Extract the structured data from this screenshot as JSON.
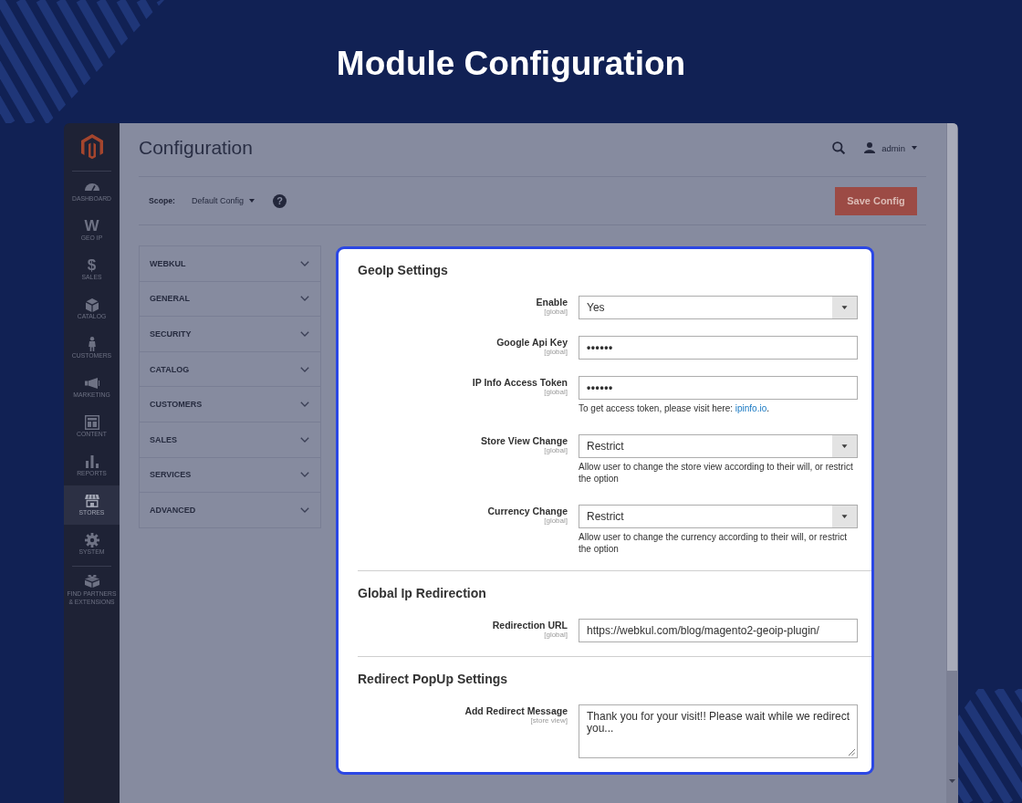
{
  "title": "Module Configuration",
  "admin_sidebar": {
    "items": [
      {
        "label": "DASHBOARD",
        "selected": false
      },
      {
        "label": "GEO IP",
        "glyph": "W",
        "selected": false
      },
      {
        "label": "SALES",
        "glyph": "$",
        "selected": false
      },
      {
        "label": "CATALOG",
        "selected": false
      },
      {
        "label": "CUSTOMERS",
        "selected": false
      },
      {
        "label": "MARKETING",
        "selected": false
      },
      {
        "label": "CONTENT",
        "selected": false
      },
      {
        "label": "REPORTS",
        "selected": false
      },
      {
        "label": "STORES",
        "selected": true
      },
      {
        "label": "SYSTEM",
        "selected": false
      },
      {
        "label": "FIND PARTNERS & EXTENSIONS",
        "selected": false
      }
    ]
  },
  "header": {
    "page_title": "Configuration",
    "user": "admin"
  },
  "scope_bar": {
    "label": "Scope:",
    "value": "Default Config",
    "help": "?",
    "save_button": "Save Config"
  },
  "config_tabs": [
    {
      "label": "WEBKUL",
      "expanded": false
    },
    {
      "label": "GENERAL",
      "expanded": false
    },
    {
      "label": "SECURITY",
      "expanded": false
    },
    {
      "label": "CATALOG",
      "expanded": false
    },
    {
      "label": "CUSTOMERS",
      "expanded": false
    },
    {
      "label": "SALES",
      "expanded": false
    },
    {
      "label": "SERVICES",
      "expanded": false
    },
    {
      "label": "ADVANCED",
      "expanded": false
    }
  ],
  "settings_panel": {
    "sections": [
      {
        "title": "GeoIp Settings",
        "fields": [
          {
            "kind": "select",
            "label": "Enable",
            "scope": "[global]",
            "value": "Yes"
          },
          {
            "kind": "password",
            "label": "Google Api Key",
            "scope": "[global]",
            "value": "••••••"
          },
          {
            "kind": "password",
            "label": "IP Info Access Token",
            "scope": "[global]",
            "value": "••••••",
            "note": "To get access token, please visit here: ",
            "note_link": "ipinfo.io",
            "note_end": "."
          },
          {
            "kind": "select",
            "label": "Store View Change",
            "scope": "[global]",
            "value": "Restrict",
            "note": "Allow user to change the store view according to their will, or restrict the option"
          },
          {
            "kind": "select",
            "label": "Currency Change",
            "scope": "[global]",
            "value": "Restrict",
            "note": "Allow user to change the currency according to their will, or restrict the option"
          }
        ]
      },
      {
        "title": "Global Ip Redirection",
        "fields": [
          {
            "kind": "text",
            "label": "Redirection URL",
            "scope": "[global]",
            "value": "https://webkul.com/blog/magento2-geoip-plugin/"
          }
        ]
      },
      {
        "title": "Redirect PopUp Settings",
        "fields": [
          {
            "kind": "textarea",
            "label": "Add Redirect Message",
            "scope": "[store view]",
            "value": "Thank you for your visit!! Please wait while we redirect you..."
          }
        ]
      }
    ]
  }
}
